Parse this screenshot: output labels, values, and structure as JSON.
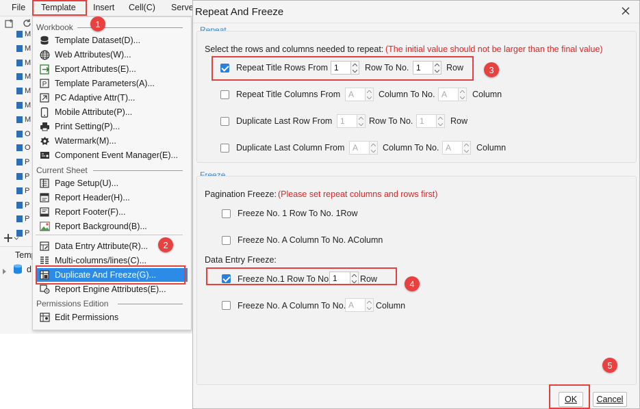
{
  "menubar": {
    "items": [
      "File",
      "Template",
      "Insert",
      "Cell(C)",
      "Serve"
    ]
  },
  "left_panel": {
    "tree_letters": [
      "M",
      "M",
      "M",
      "M",
      "M",
      "M",
      "M",
      "O",
      "O",
      "P",
      "P",
      "P",
      "P",
      "P",
      "P"
    ],
    "bottom_label": "Temp",
    "bottom_item": "d"
  },
  "template_menu": {
    "section_workbook": "Workbook",
    "workbook_items": [
      {
        "label": "Template Dataset(D)...",
        "icon": "database-icon"
      },
      {
        "label": "Web Attributes(W)...",
        "icon": "globe-icon"
      },
      {
        "label": "Export Attributes(E)...",
        "icon": "export-icon"
      },
      {
        "label": "Template Parameters(A)...",
        "icon": "parameter-icon"
      },
      {
        "label": "PC Adaptive Attr(T)...",
        "icon": "resize-icon"
      },
      {
        "label": "Mobile Attribute(P)...",
        "icon": "mobile-icon"
      },
      {
        "label": "Print Setting(P)...",
        "icon": "printer-icon"
      },
      {
        "label": "Watermark(M)...",
        "icon": "watermark-icon"
      },
      {
        "label": "Component Event Manager(E)...",
        "icon": "event-manager-icon"
      }
    ],
    "section_current_sheet": "Current Sheet",
    "sheet_items": [
      {
        "label": "Page Setup(U)...",
        "icon": "page-setup-icon"
      },
      {
        "label": "Report Header(H)...",
        "icon": "report-header-icon"
      },
      {
        "label": "Report Footer(F)...",
        "icon": "report-footer-icon"
      },
      {
        "label": "Report Background(B)..."
      }
    ],
    "sheet_items2": [
      {
        "label": "Data Entry Attribute(R)...",
        "icon": "data-entry-icon"
      },
      {
        "label": "Multi-columns/lines(C)...",
        "icon": "multi-columns-icon"
      },
      {
        "label": "Duplicate And Freeze(G)...",
        "icon": "freeze-icon",
        "selected": true
      },
      {
        "label": "Report Engine Attributes(E)...",
        "icon": "engine-icon"
      }
    ],
    "section_permissions": "Permissions Edition",
    "permission_items": [
      {
        "label": "Edit Permissions",
        "icon": "permissions-icon"
      }
    ]
  },
  "dialog": {
    "title": "Repeat And Freeze",
    "repeat": {
      "group_title": "Repeat",
      "instruction": "Select the rows and columns needed to repeat:",
      "warning": "(The initial value should not be larger than the final value)",
      "rows": [
        {
          "label": "Repeat Title Rows From",
          "checked": true,
          "from": "1",
          "mid": "Row To No.",
          "to": "1",
          "unit": "Row",
          "enabled": true
        },
        {
          "label": "Repeat Title Columns From",
          "checked": false,
          "from": "A",
          "mid": "Column To No.",
          "to": "A",
          "unit": "Column",
          "enabled": false
        },
        {
          "label": "Duplicate Last Row From",
          "checked": false,
          "from": "1",
          "mid": "Row To No.",
          "to": "1",
          "unit": "Row",
          "enabled": false
        },
        {
          "label": "Duplicate Last Column From",
          "checked": false,
          "from": "A",
          "mid": "Column To No.",
          "to": "A",
          "unit": "Column",
          "enabled": false
        }
      ]
    },
    "freeze": {
      "group_title": "Freeze",
      "pagination_label": "Pagination Freeze:",
      "pagination_warning": "(Please set repeat columns and rows first)",
      "pagination_rows": [
        {
          "label": "Freeze No. 1 Row To No.  1Row",
          "checked": false
        },
        {
          "label": "Freeze No. A Column To No.  AColumn",
          "checked": false
        }
      ],
      "data_entry_label": "Data Entry Freeze:",
      "entry_row": {
        "label": "Freeze No.1 Row To No.",
        "checked": true,
        "value": "1",
        "unit": "Row"
      },
      "entry_col": {
        "label": "Freeze No. A Column To No.",
        "checked": false,
        "value": "A",
        "unit": "Column"
      }
    },
    "buttons": {
      "ok": "OK",
      "cancel": "Cancel"
    }
  },
  "annotations": {
    "badges": [
      "1",
      "2",
      "3",
      "4",
      "5"
    ],
    "color": "#e5403e"
  },
  "colors": {
    "accent": "#2b8be6",
    "group_title": "#3c82c8",
    "warning": "#e02424"
  }
}
